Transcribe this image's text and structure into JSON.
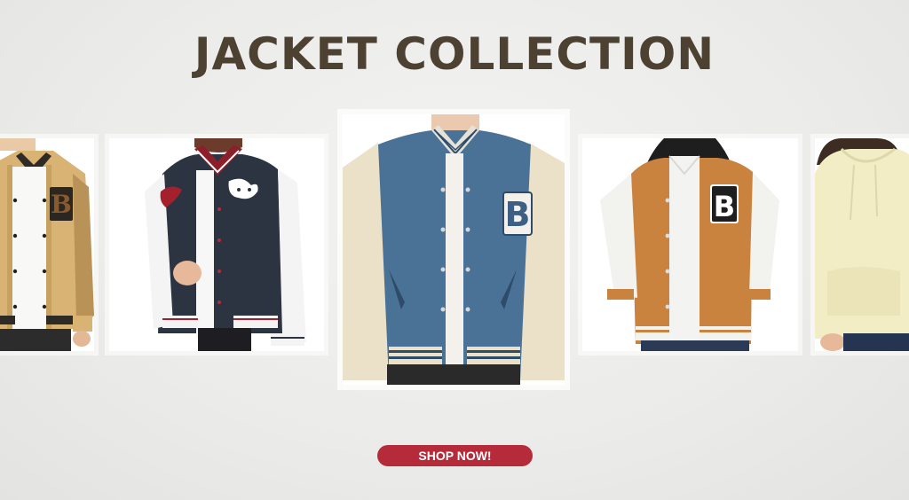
{
  "header": {
    "title": "JACKET COLLECTION"
  },
  "products": [
    {
      "name": "tan-varsity-jacket",
      "patch_letter": "B",
      "color": "#d8b373"
    },
    {
      "name": "navy-varsity-jacket",
      "color": "#2c3442"
    },
    {
      "name": "blue-varsity-jacket",
      "patch_letter": "B",
      "color": "#4a7297"
    },
    {
      "name": "orange-hooded-varsity-jacket",
      "patch_letter": "B",
      "color": "#c9833f"
    },
    {
      "name": "cream-hoodie",
      "color": "#f3edc6"
    }
  ],
  "cta": {
    "label": "SHOP NOW!",
    "color": "#b52b3a"
  },
  "colors": {
    "title": "#4d4132",
    "background": "#ebebe9"
  }
}
